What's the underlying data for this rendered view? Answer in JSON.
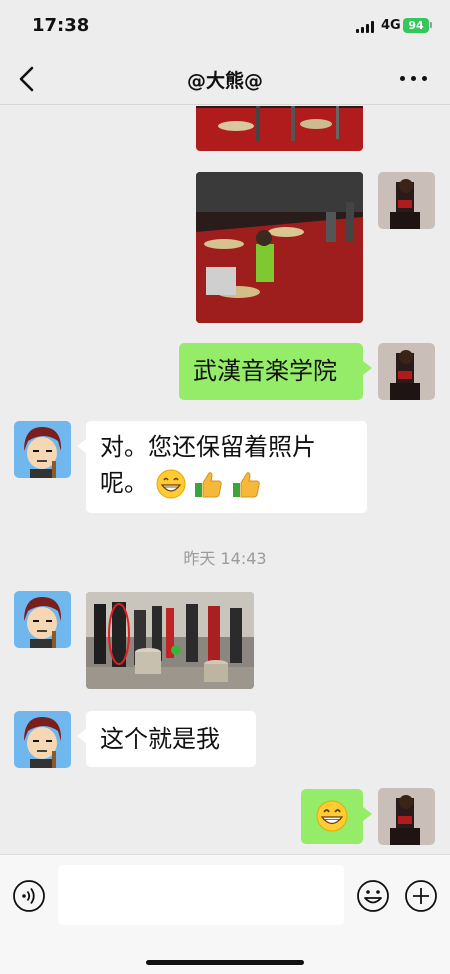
{
  "status_bar": {
    "time": "17:38",
    "network": "4G",
    "battery": "94"
  },
  "header": {
    "title": "@大熊@",
    "back_icon": "chevron-left-icon",
    "more_icon": "more-dots-icon"
  },
  "messages": [
    {
      "sender": "me",
      "type": "image",
      "description_icon": "photo-thumbnail"
    },
    {
      "sender": "me",
      "type": "image",
      "description_icon": "photo-thumbnail"
    },
    {
      "sender": "me",
      "type": "text",
      "text": "武漢音楽学院"
    },
    {
      "sender": "other",
      "type": "text",
      "line1": "对。您还保留着照片",
      "line2": "呢。"
    },
    {
      "sender": "system",
      "type": "timestamp",
      "text": "昨天 14:43"
    },
    {
      "sender": "other",
      "type": "image",
      "description_icon": "photo-thumbnail"
    },
    {
      "sender": "other",
      "type": "text",
      "text": "这个就是我"
    },
    {
      "sender": "me",
      "type": "emoji",
      "emoji": "grin-emoji"
    }
  ],
  "input_bar": {
    "voice_icon": "voice-icon",
    "emoji_icon": "emoji-icon",
    "plus_icon": "plus-icon",
    "placeholder": ""
  },
  "colors": {
    "background": "#ededed",
    "bubble_me": "#95ec69",
    "bubble_other": "#ffffff",
    "battery": "#34c759"
  }
}
